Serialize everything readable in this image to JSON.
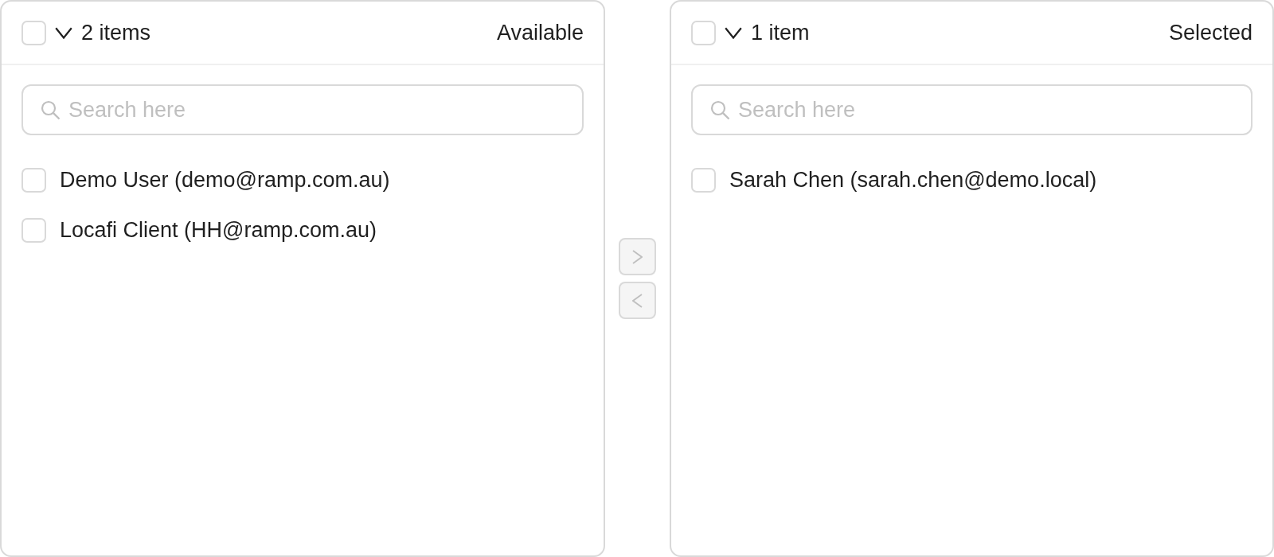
{
  "panels": [
    {
      "header": {
        "checked": false,
        "count": "2 items",
        "title": "Available"
      },
      "search": {
        "placeholder": "Search here"
      },
      "items": [
        {
          "label": "Demo User (demo@ramp.com.au)",
          "checked": false
        },
        {
          "label": "Locafi Client (HH@ramp.com.au)",
          "checked": false
        }
      ]
    },
    {
      "header": {
        "checked": false,
        "count": "1 item",
        "title": "Selected"
      },
      "search": {
        "placeholder": "Search here"
      },
      "items": [
        {
          "label": "Sarah Chen (sarah.chen@demo.local)",
          "checked": false
        }
      ]
    }
  ],
  "transfer_buttons": [
    {
      "kind": "right",
      "disabled": true
    },
    {
      "kind": "left",
      "disabled": true
    }
  ]
}
